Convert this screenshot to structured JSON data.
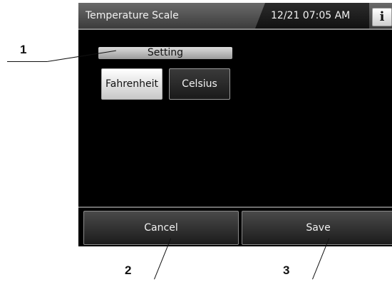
{
  "header": {
    "title": "Temperature Scale",
    "datetime": "12/21 07:05 AM",
    "info_label": "i"
  },
  "setting": {
    "label": "Setting",
    "options": [
      {
        "label": "Fahrenheit",
        "selected": true
      },
      {
        "label": "Celsius",
        "selected": false
      }
    ]
  },
  "footer": {
    "cancel_label": "Cancel",
    "save_label": "Save"
  },
  "callouts": [
    "1",
    "2",
    "3"
  ]
}
